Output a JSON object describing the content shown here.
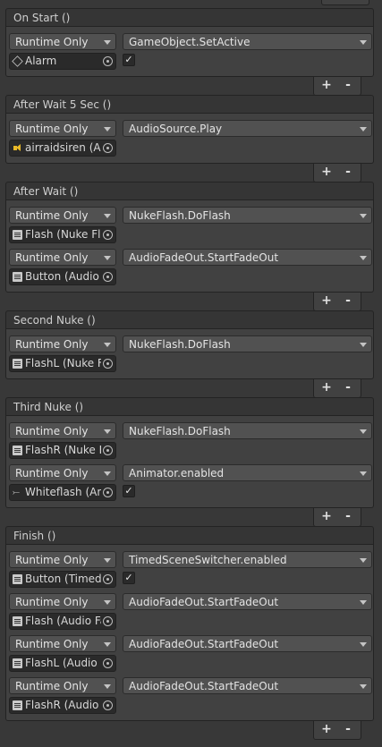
{
  "events": [
    {
      "title": "On Start ()",
      "entries": [
        {
          "mode": "Runtime Only",
          "function": "GameObject.SetActive",
          "object": "Alarm",
          "icon": "cube-icon",
          "checkbox": true
        }
      ]
    },
    {
      "title": "After Wait 5 Sec ()",
      "entries": [
        {
          "mode": "Runtime Only",
          "function": "AudioSource.Play",
          "object": "airraidsiren (Au",
          "icon": "audio-source-icon",
          "checkbox": false
        }
      ]
    },
    {
      "title": "After Wait ()",
      "entries": [
        {
          "mode": "Runtime Only",
          "function": "NukeFlash.DoFlash",
          "object": "Flash (Nuke Fla",
          "icon": "script-icon",
          "checkbox": false
        },
        {
          "mode": "Runtime Only",
          "function": "AudioFadeOut.StartFadeOut",
          "object": "Button (Audio I",
          "icon": "script-icon",
          "checkbox": false
        }
      ]
    },
    {
      "title": "Second Nuke ()",
      "entries": [
        {
          "mode": "Runtime Only",
          "function": "NukeFlash.DoFlash",
          "object": "FlashL (Nuke F",
          "icon": "script-icon",
          "checkbox": false
        }
      ]
    },
    {
      "title": "Third Nuke ()",
      "entries": [
        {
          "mode": "Runtime Only",
          "function": "NukeFlash.DoFlash",
          "object": "FlashR (Nuke F",
          "icon": "script-icon",
          "checkbox": false
        },
        {
          "mode": "Runtime Only",
          "function": "Animator.enabled",
          "object": "Whiteflash (An",
          "icon": "animator-icon",
          "checkbox": true
        }
      ]
    },
    {
      "title": "Finish ()",
      "entries": [
        {
          "mode": "Runtime Only",
          "function": "TimedSceneSwitcher.enabled",
          "object": "Button (Timed",
          "icon": "script-icon",
          "checkbox": true
        },
        {
          "mode": "Runtime Only",
          "function": "AudioFadeOut.StartFadeOut",
          "object": "Flash (Audio Fa",
          "icon": "script-icon",
          "checkbox": false
        },
        {
          "mode": "Runtime Only",
          "function": "AudioFadeOut.StartFadeOut",
          "object": "FlashL (Audio F",
          "icon": "script-icon",
          "checkbox": false
        },
        {
          "mode": "Runtime Only",
          "function": "AudioFadeOut.StartFadeOut",
          "object": "FlashR (Audio I",
          "icon": "script-icon",
          "checkbox": false
        }
      ]
    }
  ],
  "footer": {
    "plus": "+",
    "minus": "-"
  },
  "checkmark": "✓",
  "colors": {
    "panel_bg": "#383838",
    "event_bg": "#414141",
    "dropdown_bg": "#515151",
    "object_bg": "#2a2a2a",
    "audio_icon": "#e8b928"
  }
}
